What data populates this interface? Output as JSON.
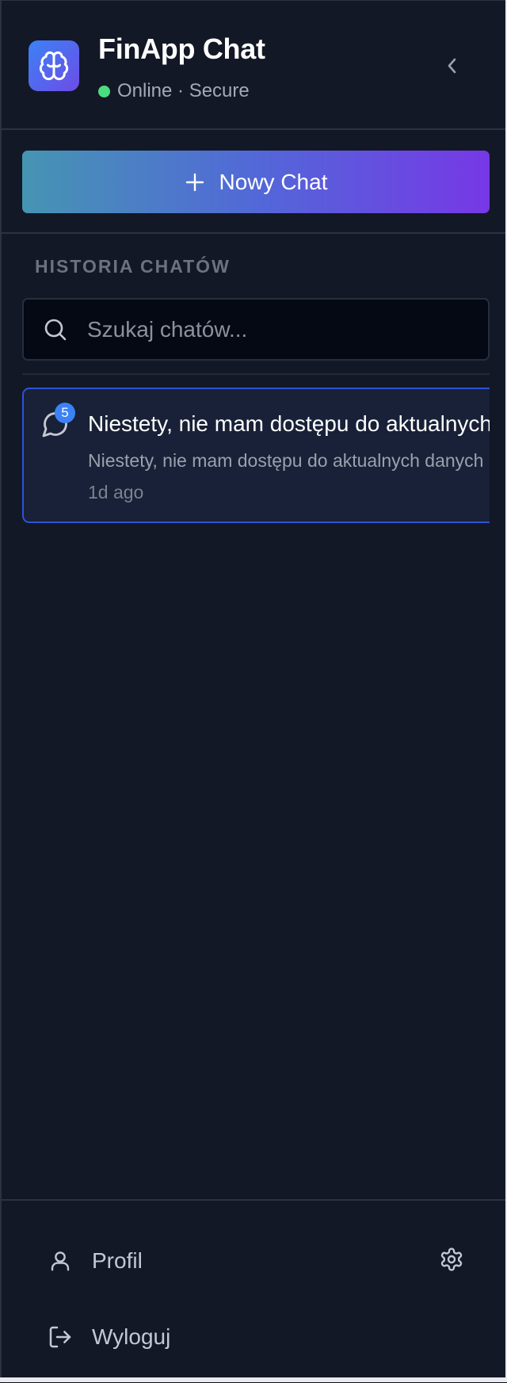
{
  "app": {
    "title": "FinApp Chat",
    "status": "Online · Secure",
    "brand_gradient": [
      "#3b82f6",
      "#6d4ce6"
    ],
    "status_color": "#4ade80"
  },
  "sidebar": {
    "new_chat_label": "Nowy Chat",
    "history_label": "HISTORIA CHATÓW",
    "search_placeholder": "Szukaj chatów..."
  },
  "chats": [
    {
      "title": "Niestety, nie mam dostępu do aktualnych danych",
      "preview": "Niestety, nie mam dostępu do aktualnych danych",
      "time": "1d ago",
      "badge": "5"
    }
  ],
  "footer": {
    "profile_label": "Profil",
    "logout_label": "Wyloguj"
  },
  "icons": {
    "logo": "brain-icon",
    "collapse": "chevron-left-icon",
    "new_chat": "plus-icon",
    "search": "search-icon",
    "chat": "message-circle-icon",
    "profile": "user-icon",
    "settings": "gear-icon",
    "logout": "logout-icon"
  }
}
